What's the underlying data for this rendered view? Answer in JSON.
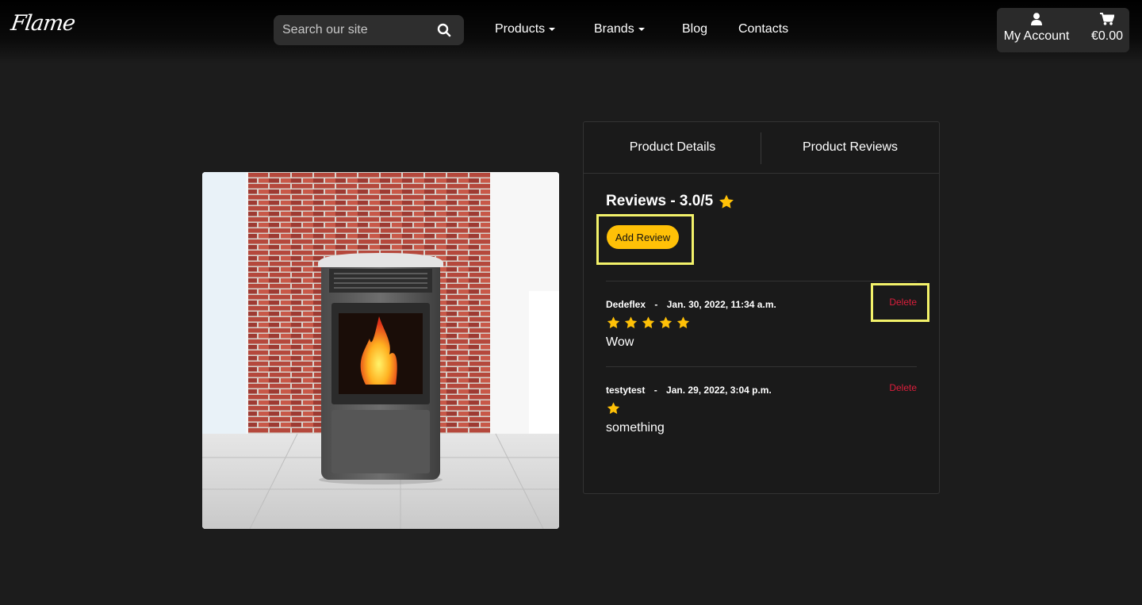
{
  "brand": {
    "logo_text": "Flame"
  },
  "search": {
    "placeholder": "Search our site"
  },
  "nav": {
    "products": "Products",
    "brands": "Brands",
    "blog": "Blog",
    "contacts": "Contacts"
  },
  "account": {
    "label": "My Account",
    "cart_total": "€0.00"
  },
  "tabs": {
    "details": "Product Details",
    "reviews": "Product Reviews"
  },
  "reviews_section": {
    "title": "Reviews - 3.0/5",
    "add_button": "Add Review",
    "star_color": "#ffc107",
    "delete_color": "#dc1e3c",
    "items": [
      {
        "author": "Dedeflex",
        "separator": "-",
        "date": "Jan. 30, 2022, 11:34 a.m.",
        "rating": 5,
        "text": "Wow",
        "delete_label": "Delete"
      },
      {
        "author": "testytest",
        "separator": "-",
        "date": "Jan. 29, 2022, 3:04 p.m.",
        "rating": 1,
        "text": "something",
        "delete_label": "Delete"
      }
    ]
  }
}
